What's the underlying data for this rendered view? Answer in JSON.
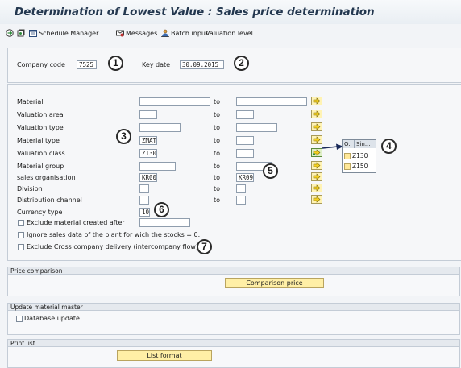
{
  "title": "Determination of Lowest Value : Sales price determination",
  "toolbar": {
    "icon1": "execute-icon",
    "icon2": "variant-icon",
    "schedule_manager": "Schedule Manager",
    "messages": "Messages",
    "batch_input": "Batch input",
    "valuation_level": "Valuation level"
  },
  "header_fields": {
    "company_code_label": "Company code",
    "company_code_value": "7525",
    "key_date_label": "Key date",
    "key_date_value": "30.09.2015"
  },
  "selection": {
    "to_label": "to",
    "rows": [
      {
        "label": "Material",
        "from": "",
        "to": ""
      },
      {
        "label": "Valuation area",
        "from": "",
        "to": ""
      },
      {
        "label": "Valuation type",
        "from": "",
        "to": ""
      },
      {
        "label": "Material type",
        "from": "ZMAT",
        "to": ""
      },
      {
        "label": "Valuation class",
        "from": "Z130",
        "to": ""
      },
      {
        "label": "Material group",
        "from": "",
        "to": ""
      },
      {
        "label": "sales organisation",
        "from": "KR00",
        "to": "KR09"
      },
      {
        "label": "Division",
        "from": "",
        "to": ""
      },
      {
        "label": "Distribution channel",
        "from": "",
        "to": ""
      }
    ],
    "currency_type_label": "Currency type",
    "currency_type_value": "10",
    "excl_material_label": "Exclude  material created after",
    "excl_material_value": "",
    "ignore_sales_label": "Ignore sales data of the plant for wich the stocks = 0.",
    "excl_cross_label": "Exclude Cross company delivery  (intercompany flow)"
  },
  "popup": {
    "col1": "O..",
    "col2": "Sin...",
    "items": [
      "Z130",
      "Z150"
    ]
  },
  "callouts": [
    "1",
    "2",
    "3",
    "4",
    "5",
    "6",
    "7"
  ],
  "price_comparison": {
    "header": "Price comparison",
    "button": "Comparison price"
  },
  "update_master": {
    "header": "Update material master",
    "checkbox": "Database update"
  },
  "print_list": {
    "header": "Print list",
    "button": "List format"
  },
  "colors": {
    "title_text": "#23374f",
    "button_yellow": "#ffefa6",
    "arrow_green": "#2e8b3a"
  }
}
